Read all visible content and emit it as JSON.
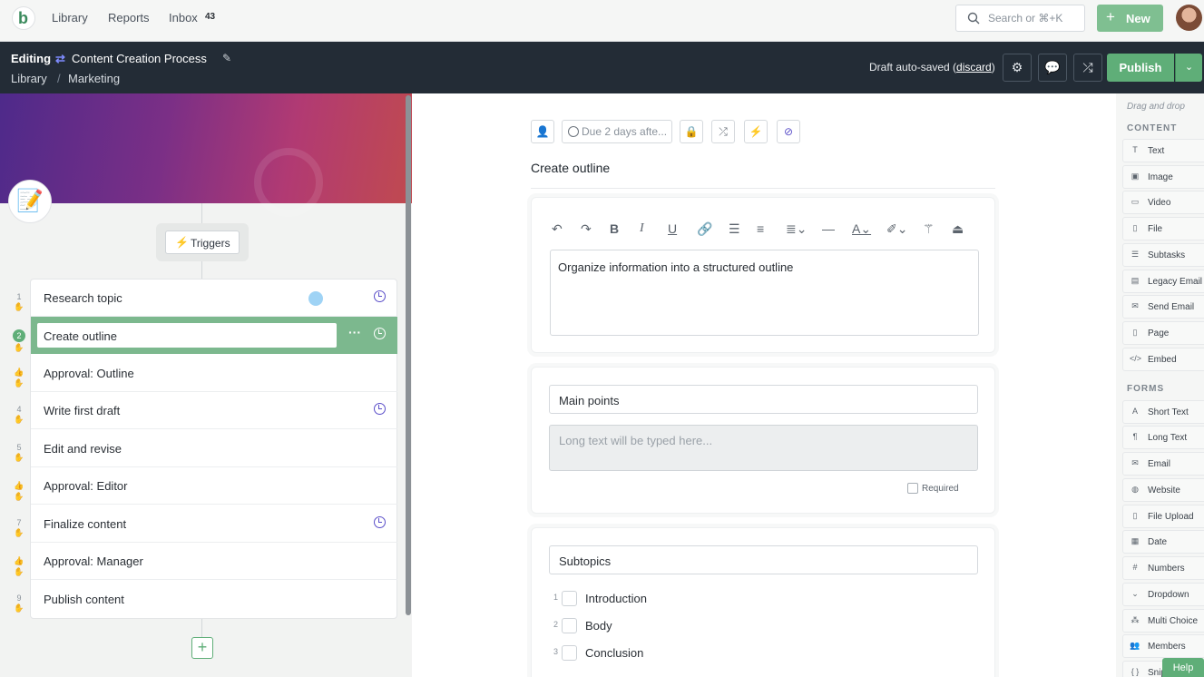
{
  "topnav": {
    "logo": "b",
    "links": [
      "Library",
      "Reports",
      "Inbox"
    ],
    "inbox_count": "43",
    "search_placeholder": "Search or ⌘+K",
    "new_label": "New"
  },
  "editbar": {
    "mode": "Editing",
    "title": "Content Creation Process",
    "breadcrumb": [
      "Library",
      "Marketing"
    ],
    "breadcrumb_sep": "/",
    "autosave_prefix": "Draft auto-saved (",
    "autosave_link": "discard",
    "autosave_suffix": ")",
    "publish_label": "Publish"
  },
  "left": {
    "triggers_label": "Triggers",
    "emoji": "📝",
    "tasks": [
      {
        "num": "1",
        "name": "Research topic",
        "clock": true,
        "approval": false
      },
      {
        "num": "2",
        "name": "Create outline",
        "clock": true,
        "approval": false,
        "active": true
      },
      {
        "num": "",
        "name": "Approval: Outline",
        "clock": false,
        "approval": true
      },
      {
        "num": "4",
        "name": "Write first draft",
        "clock": true,
        "approval": false
      },
      {
        "num": "5",
        "name": "Edit and revise",
        "clock": false,
        "approval": false
      },
      {
        "num": "",
        "name": "Approval: Editor",
        "clock": false,
        "approval": true
      },
      {
        "num": "7",
        "name": "Finalize content",
        "clock": true,
        "approval": false
      },
      {
        "num": "",
        "name": "Approval: Manager",
        "clock": false,
        "approval": true
      },
      {
        "num": "9",
        "name": "Publish content",
        "clock": false,
        "approval": false
      }
    ],
    "add_label": "+"
  },
  "main": {
    "due_label": "Due 2 days afte...",
    "step_title": "Create outline",
    "description": "Organize information into a structured outline",
    "form1": {
      "label": "Main points",
      "placeholder": "Long text will be typed here...",
      "required_label": "Required"
    },
    "form2": {
      "label": "Subtopics",
      "items": [
        {
          "num": "1",
          "label": "Introduction"
        },
        {
          "num": "2",
          "label": "Body"
        },
        {
          "num": "3",
          "label": "Conclusion"
        }
      ]
    }
  },
  "rightbar": {
    "hint": "Drag and drop",
    "content_heading": "CONTENT",
    "content_items": [
      "Text",
      "Image",
      "Video",
      "File",
      "Subtasks",
      "Legacy Email",
      "Send Email",
      "Page",
      "Embed"
    ],
    "forms_heading": "FORMS",
    "form_items": [
      "Short Text",
      "Long Text",
      "Email",
      "Website",
      "File Upload",
      "Date",
      "Numbers",
      "Dropdown",
      "Multi Choice",
      "Members",
      "Snippet"
    ],
    "help_label": "Help"
  }
}
